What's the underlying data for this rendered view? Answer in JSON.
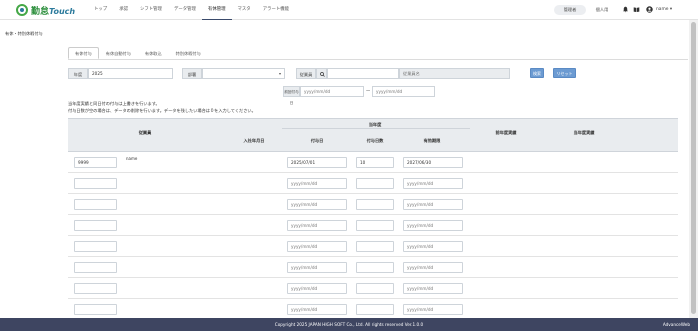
{
  "header": {
    "logo_text_1": "勤怠",
    "logo_text_2": "Touch",
    "nav": [
      "トップ",
      "承認",
      "シフト管理",
      "データ管理",
      "有休管理",
      "マスタ",
      "アラート機能"
    ],
    "nav_active": "有休管理",
    "admin_label": "管理者",
    "personal_label": "個人用",
    "user_name": "name ▾"
  },
  "breadcrumb": "有休・特別休暇付与",
  "tabs": [
    "有休付与",
    "有休自動付与",
    "有休取込",
    "特別休暇付与"
  ],
  "filters": {
    "year_label": "年度",
    "year_value": "2025",
    "dept_label": "部署",
    "employee_label": "従業員",
    "employee_placeholder": "従業員名",
    "search_button": "検索",
    "reset_button": "リセット",
    "grant_date_label": "前回付与日",
    "date_placeholder": "yyyy/mm/dd",
    "tilde": "〜"
  },
  "notes": [
    "当年度実績と同日付の付与は上書きを行います。",
    "付与日数が空の場合は、データの削除を行います。データを残したい場合は０を入力してください。"
  ],
  "table": {
    "col_employee": "従業員",
    "col_hire": "入社年月日",
    "group_current": "当年度",
    "col_grant_date": "付与日",
    "col_grant_days": "付与日数",
    "col_expiry": "有効期限",
    "col_prev_actual": "前年度実績",
    "col_curr_actual": "当年度実績",
    "date_placeholder": "yyyy/mm/dd",
    "rows": [
      {
        "code": "9999",
        "name": "name",
        "grant_date": "2025/07/01",
        "days": "10",
        "expiry": "2027/06/30"
      },
      {
        "code": "",
        "name": "",
        "grant_date": "",
        "days": "",
        "expiry": ""
      },
      {
        "code": "",
        "name": "",
        "grant_date": "",
        "days": "",
        "expiry": ""
      },
      {
        "code": "",
        "name": "",
        "grant_date": "",
        "days": "",
        "expiry": ""
      },
      {
        "code": "",
        "name": "",
        "grant_date": "",
        "days": "",
        "expiry": ""
      },
      {
        "code": "",
        "name": "",
        "grant_date": "",
        "days": "",
        "expiry": ""
      },
      {
        "code": "",
        "name": "",
        "grant_date": "",
        "days": "",
        "expiry": ""
      },
      {
        "code": "",
        "name": "",
        "grant_date": "",
        "days": "",
        "expiry": ""
      }
    ]
  },
  "footer": {
    "copyright": "Copyright 2025 JAPAN HIGH SOFT Co., Ltd. All rights reserved  Ver.1.0.0",
    "brand": "AdvanceWeb"
  }
}
